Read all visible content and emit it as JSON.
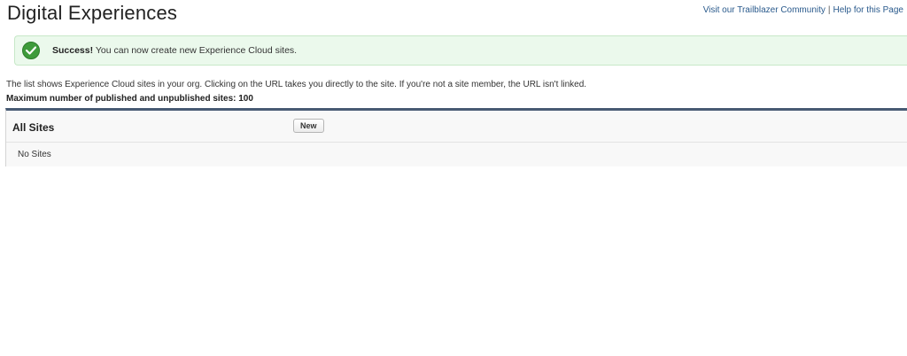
{
  "header": {
    "title": "Digital Experiences",
    "links": [
      {
        "label": "Visit our Trailblazer Community"
      },
      {
        "label": "Help for this Page"
      }
    ],
    "separator": "|"
  },
  "alert": {
    "strong": "Success!",
    "message": " You can now create new Experience Cloud sites.",
    "icon": "checkmark-icon",
    "color": "#3e9b3b"
  },
  "info": {
    "description": "The list shows Experience Cloud sites in your org. Clicking on the URL takes you directly to the site. If you're not a site member, the URL isn't linked.",
    "max_label": "Maximum number of published and unpublished sites: 100"
  },
  "sites": {
    "title": "All Sites",
    "new_label": "New",
    "empty_text": "No Sites",
    "accent": "#475a73"
  }
}
